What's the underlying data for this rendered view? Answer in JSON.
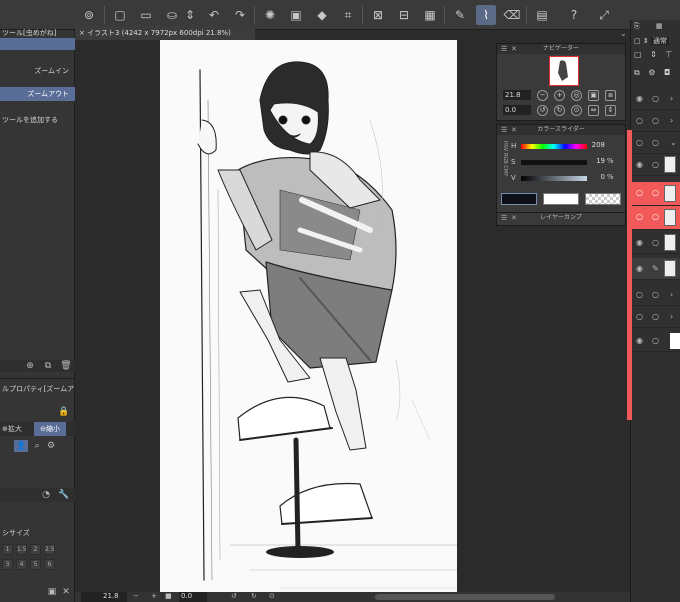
{
  "document": {
    "tab_label": "イラスト3 (4242 x 7972px 600dpi 21.8%)",
    "close_glyph": "×"
  },
  "left_panel": {
    "tool_title": "ツール[虫めがね]",
    "zoom_in": "ズームイン",
    "zoom_out": "ズームアウト",
    "add_tool": "ツールを追加する",
    "props_title": "ルプロパティ[ズームアウ",
    "zoom_in_btn": "拡大",
    "zoom_out_btn": "縮小",
    "size_title": "シサイズ",
    "brush_sizes": [
      "1",
      "1.5",
      "2",
      "2.5",
      "3",
      "4",
      "5",
      "6"
    ]
  },
  "navigator": {
    "title": "ナビゲーター",
    "zoom_value": "21.8",
    "rotate_value": "0.0"
  },
  "color_slider": {
    "title": "カラースライダー",
    "side_label": "HSV RGB CMY",
    "h_label": "H",
    "h_value": "208",
    "s_label": "S",
    "s_value": "19",
    "s_unit": "%",
    "v_label": "V",
    "v_value": "0",
    "v_unit": "%",
    "main_color": "#0d1017",
    "sub_color": "#ffffff"
  },
  "layer_comp": {
    "title": "レイヤーカンプ"
  },
  "layer_panel": {
    "blend_mode": "通常"
  },
  "status": {
    "zoom": "21.8",
    "rotation": "0.0"
  },
  "colors": {
    "accent": "#5a6d96",
    "layer_red": "#f25a5a",
    "panel_bg": "#353535"
  }
}
